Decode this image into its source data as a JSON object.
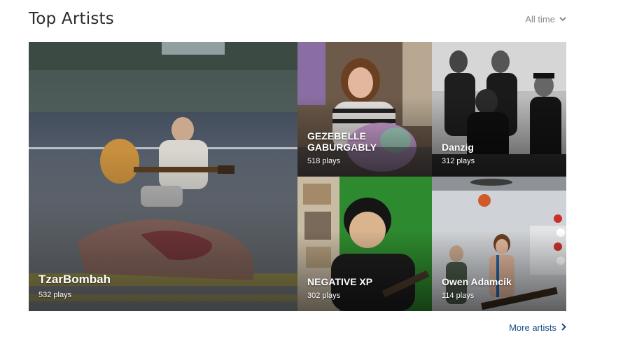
{
  "section": {
    "title": "Top Artists",
    "time_range": "All time",
    "more_label": "More artists"
  },
  "artists": [
    {
      "name": "TzarBombah",
      "plays": "532 plays"
    },
    {
      "name": "GEZEBELLE GABURGABLY",
      "plays": "518 plays"
    },
    {
      "name": "Danzig",
      "plays": "312 plays"
    },
    {
      "name": "NEGATIVE XP",
      "plays": "302 plays"
    },
    {
      "name": "Owen Adamcik",
      "plays": "114 plays"
    }
  ],
  "colors": {
    "link": "#1a4e8a",
    "muted": "#8a8a8a"
  },
  "icons": {
    "range_dropdown": "chevron-down-icon",
    "more": "chevron-right-icon"
  }
}
